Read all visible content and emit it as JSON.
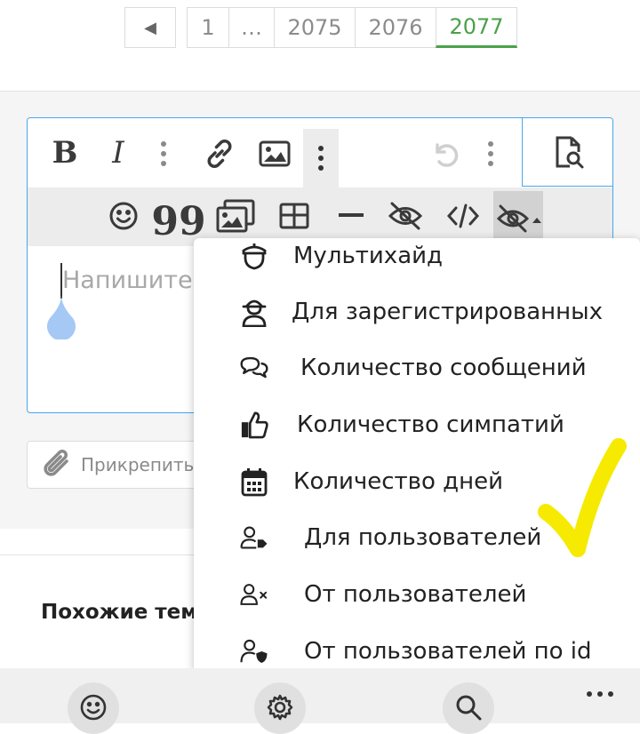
{
  "pagination": {
    "prev_icon": "chevron-left-icon",
    "pages": [
      "1",
      "…",
      "2075",
      "2076",
      "2077"
    ],
    "current": "2077"
  },
  "editor": {
    "placeholder": "Напишите",
    "toolbar_row1": [
      "bold-icon",
      "italic-icon",
      "more-vertical-icon",
      "link-icon",
      "image-icon",
      "more-vertical-icon",
      "undo-icon",
      "more-vertical-icon",
      "preview-icon"
    ],
    "toolbar_row2": [
      "smile-icon",
      "quote-icon",
      "gallery-icon",
      "table-icon",
      "horizontal-line-icon",
      "hide-icon",
      "code-icon",
      "hide-dropdown-icon"
    ]
  },
  "attach": {
    "label": "Прикрепить"
  },
  "similar": {
    "heading": "Похожие тем"
  },
  "hide_menu": {
    "items": [
      {
        "label": "Мультихайд",
        "icon": "acorn-icon"
      },
      {
        "label": "Для зарегистрированных",
        "icon": "user-secret-icon"
      },
      {
        "label": "Количество сообщений",
        "icon": "comments-icon"
      },
      {
        "label": "Количество симпатий",
        "icon": "thumbs-up-icon"
      },
      {
        "label": "Количество дней",
        "icon": "calendar-icon"
      },
      {
        "label": "Для пользователей",
        "icon": "user-tag-icon"
      },
      {
        "label": "От пользователей",
        "icon": "user-times-icon"
      },
      {
        "label": "От пользователей по id",
        "icon": "user-shield-icon"
      }
    ]
  },
  "bottom_nav": [
    "smile-icon",
    "gear-icon",
    "search-icon",
    "more-horizontal-icon"
  ],
  "colors": {
    "accent": "#4aa14a",
    "editor_border": "#47a7eb",
    "checkmark": "#f5ea00"
  }
}
